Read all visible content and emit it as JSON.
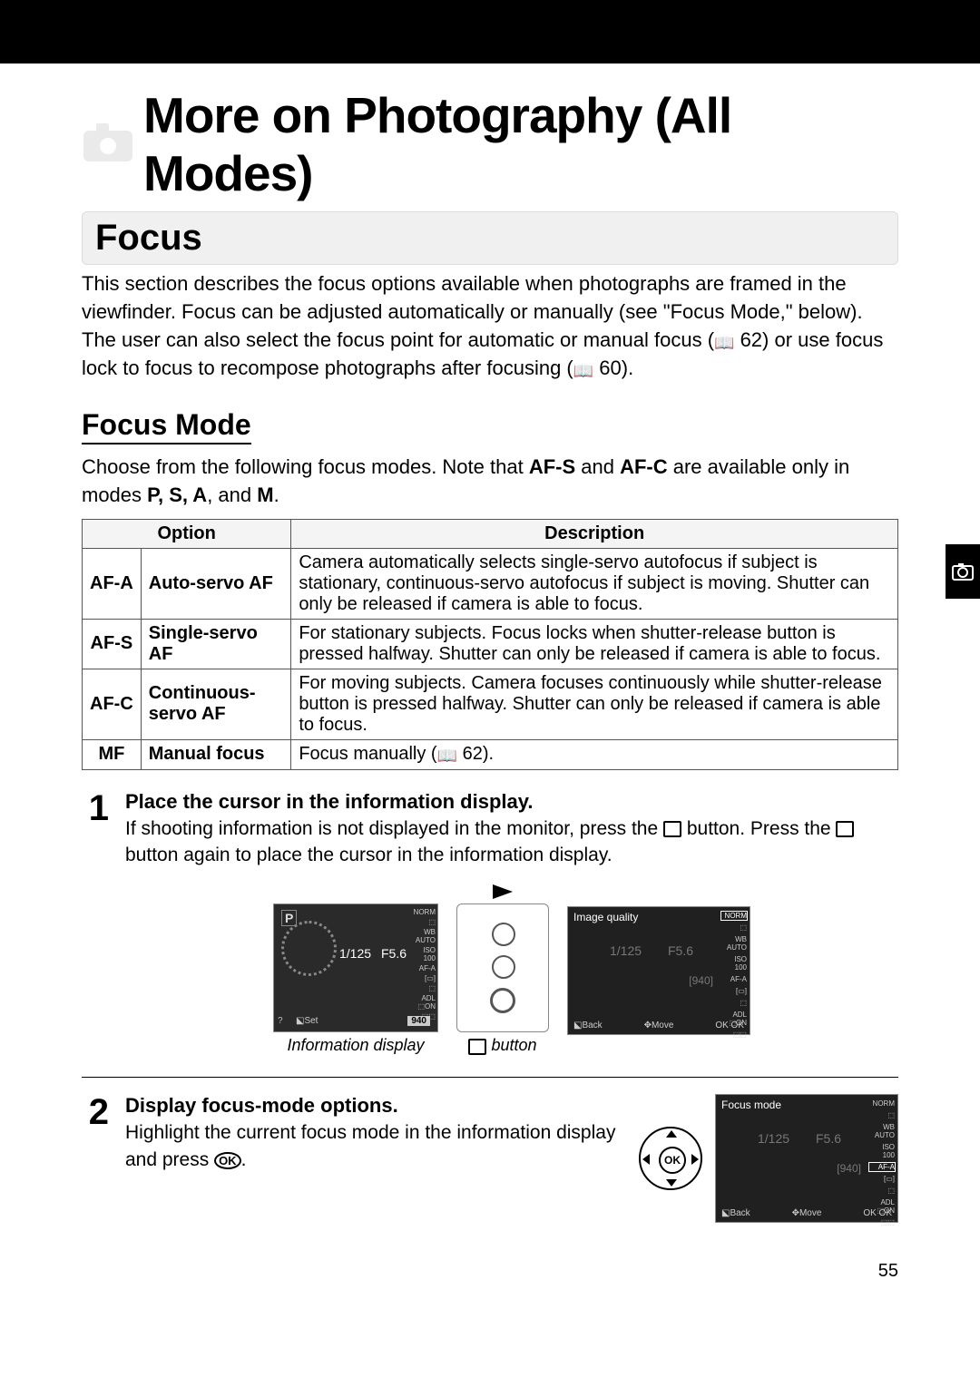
{
  "chapter_title": "More on Photography (All Modes)",
  "section": {
    "title": "Focus",
    "intro_prefix": "This section describes the focus options available when photographs are framed in the viewfinder.  Focus can be adjusted automatically or manually (see \"Focus Mode,\" below).  The user can also select the focus point for automatic or manual focus (",
    "intro_ref1": " 62) or use focus lock to focus to recompose photographs after focusing (",
    "intro_ref2": " 60)."
  },
  "focus_mode": {
    "heading": "Focus Mode",
    "lead_a": "Choose from the following focus modes.  Note that ",
    "lead_afs": "AF-S",
    "lead_b": " and ",
    "lead_afc": "AF-C",
    "lead_c": " are available only in modes ",
    "lead_modes": "P, S, A",
    "lead_d": ", and ",
    "lead_m": "M",
    "lead_e": ".",
    "table": {
      "col_option": "Option",
      "col_desc": "Description",
      "rows": [
        {
          "code": "AF-A",
          "name": "Auto-servo AF",
          "desc": "Camera automatically selects single-servo autofocus if subject is stationary, continuous-servo autofocus if subject is moving.  Shutter can only be released if camera is able to focus."
        },
        {
          "code": "AF-S",
          "name": "Single-servo AF",
          "desc": "For stationary subjects. Focus locks when shutter-release button is pressed halfway.  Shutter can only be released if camera is able to focus."
        },
        {
          "code": "AF-C",
          "name": "Continuous-servo AF",
          "desc": "For moving subjects. Camera focuses continuously while shutter-release button is pressed halfway.  Shutter can only be released if camera is able to focus."
        },
        {
          "code": "MF",
          "name": "Manual focus",
          "desc_prefix": "Focus manually (",
          "desc_ref": " 62)."
        }
      ]
    }
  },
  "steps": {
    "s1": {
      "num": "1",
      "title": "Place the cursor in the information display.",
      "text_a": "If shooting information is not displayed in the monitor, press the ",
      "text_b": " button. Press the ",
      "text_c": " button again to place the cursor in the information display.",
      "fig1_caption": "Information display",
      "fig2_caption_suffix": " button",
      "disp": {
        "mode": "P",
        "shutter": "1/125",
        "aperture": "F5.6",
        "count": "940",
        "set": "⬕Set",
        "side": [
          "NORM",
          "⬚",
          "WB AUTO",
          "ISO 100",
          "AF-A",
          "[▭]",
          "⬚",
          "ADL ⬚ON",
          "⬚⬚"
        ],
        "q": "?"
      },
      "menu": {
        "title": "Image quality",
        "shutter": "1/125",
        "aperture": "F5.6",
        "count": "[940]",
        "side": [
          "NORM",
          "⬚",
          "WB AUTO",
          "ISO 100",
          "AF-A",
          "[▭]",
          "⬚",
          "ADL ⬚ON",
          "⬚⬚"
        ],
        "row": {
          "back": "⬕Back",
          "move": "✥Move",
          "ok": "OK OK"
        }
      }
    },
    "s2": {
      "num": "2",
      "title": "Display focus-mode options.",
      "text_a": "Highlight the current focus mode in the information display and press ",
      "text_b": ".",
      "ok": "OK",
      "menu": {
        "title": "Focus mode",
        "shutter": "1/125",
        "aperture": "F5.6",
        "count": "[940]",
        "side": [
          "NORM",
          "⬚",
          "WB AUTO",
          "ISO 100",
          "AF-A",
          "[▭]",
          "⬚",
          "ADL ⬚ON",
          "⬚⬚"
        ],
        "highlight_index": 4,
        "row": {
          "back": "⬕Back",
          "move": "✥Move",
          "ok": "OK OK"
        }
      }
    }
  },
  "page_number": "55"
}
